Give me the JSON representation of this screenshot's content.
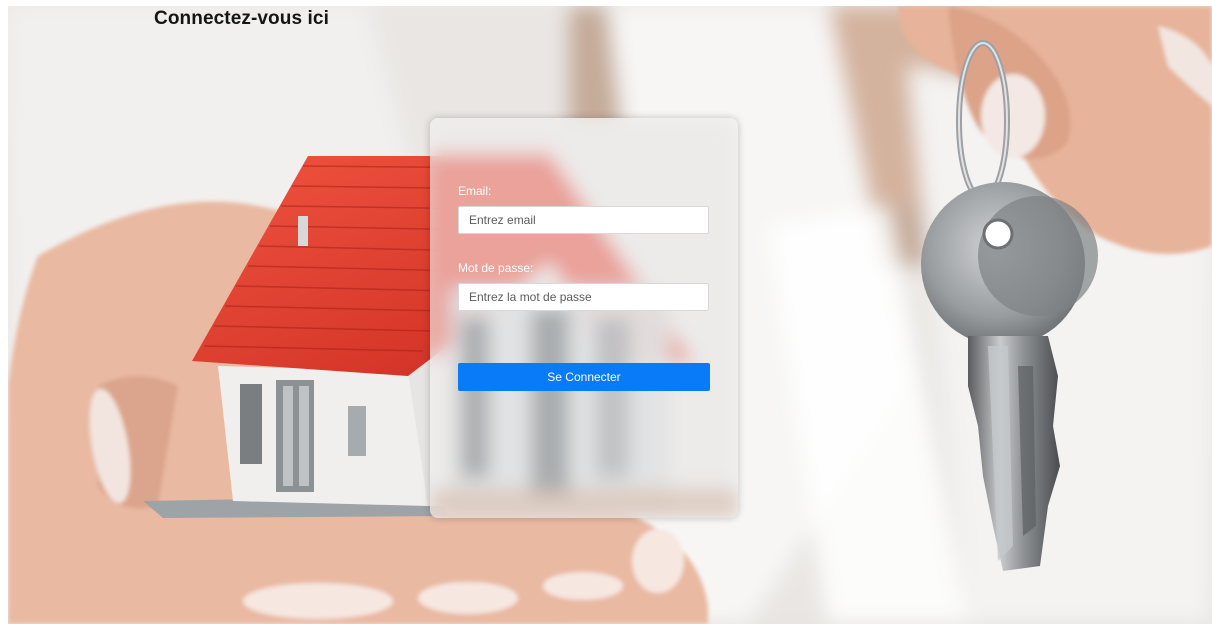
{
  "page": {
    "title": "Connectez-vous ici"
  },
  "login_form": {
    "email_label": "Email:",
    "email_placeholder": "Entrez email",
    "password_label": "Mot de passe:",
    "password_placeholder": "Entrez la mot de passe",
    "submit_label": "Se Connecter"
  },
  "colors": {
    "button": "#0a7bf8",
    "roof": "#e63b2c",
    "text": "#151515"
  }
}
